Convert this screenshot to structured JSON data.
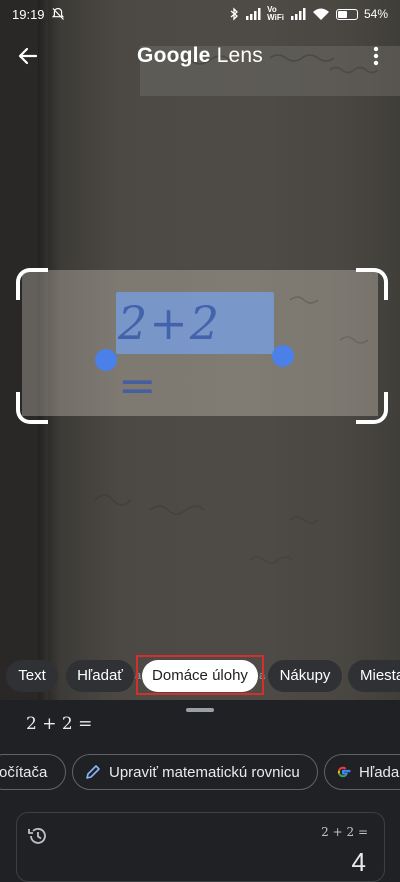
{
  "status_bar": {
    "time": "19:19",
    "network_label": "Vo\nWiFi",
    "battery_text": "54%",
    "battery_level": 0.54
  },
  "top_bar": {
    "title_brand": "Google",
    "title_product": "Lens"
  },
  "selection": {
    "text": "2+2 ="
  },
  "mode_chips": [
    {
      "label": "Text",
      "active": false
    },
    {
      "label": "Hľadať",
      "active": false
    },
    {
      "label": "Domáce úlohy",
      "active": true
    },
    {
      "label": "Nákupy",
      "active": false
    },
    {
      "label": "Miesta",
      "active": false
    }
  ],
  "chip_gap_text": "a",
  "sheet": {
    "query": "2 + 2 =",
    "actions": [
      {
        "label": "očítača",
        "icon": "none"
      },
      {
        "label": "Upraviť matematickú rovnicu",
        "icon": "pencil-icon"
      },
      {
        "label": "Hľada",
        "icon": "google-icon"
      }
    ],
    "result": {
      "expression": "2 + 2 =",
      "value": "4"
    }
  },
  "colors": {
    "accent": "#4a80e8",
    "highlight": "#d32f2f",
    "sheet_bg": "#202124"
  }
}
